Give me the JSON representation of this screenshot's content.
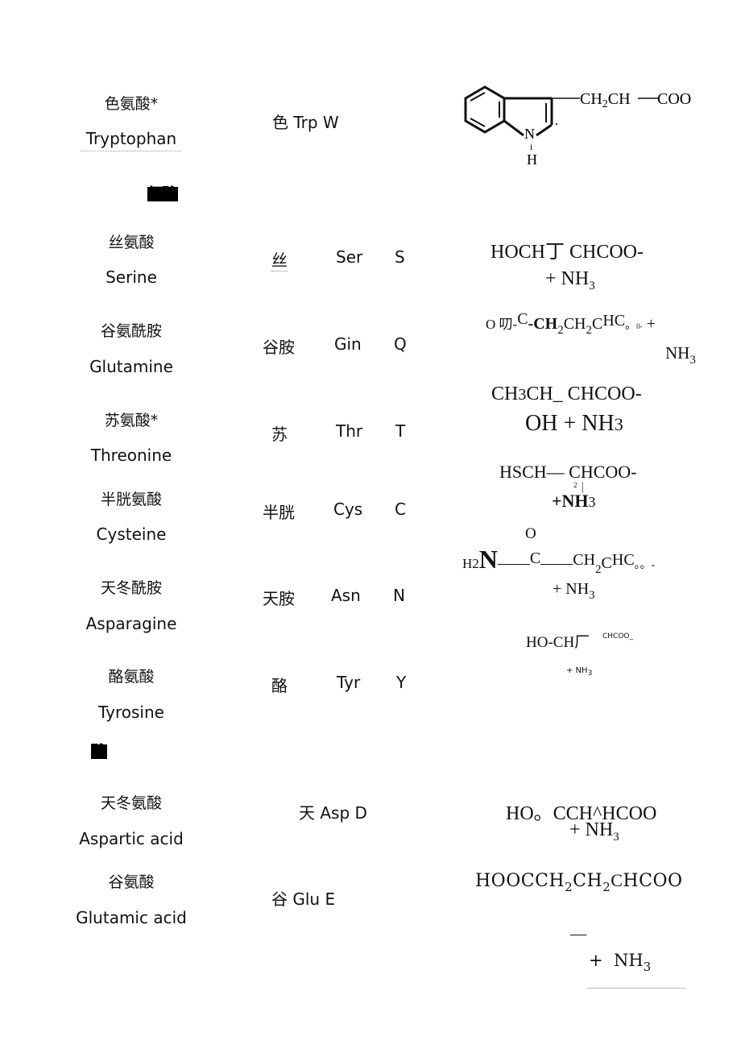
{
  "rows": [
    {
      "cn": "色氨酸*",
      "en": "Tryptophan",
      "short_cn": "色",
      "three": "Trp",
      "one": "W",
      "inline_abbr": "色  Trp W"
    },
    {
      "cn": "丝氨酸",
      "en": "Serine",
      "short_cn": "丝",
      "three": "Ser",
      "one": "S"
    },
    {
      "cn": "谷氨酰胺",
      "en": "Glutamine",
      "short_cn": "谷胺",
      "three": "Gin",
      "one": "Q"
    },
    {
      "cn": "苏氨酸*",
      "en": "Threonine",
      "short_cn": "苏",
      "three": "Thr",
      "one": "T"
    },
    {
      "cn": "半胱氨酸",
      "en": "Cysteine",
      "short_cn": "半胱",
      "three": "Cys",
      "one": "C"
    },
    {
      "cn": "天冬酰胺",
      "en": "Asparagine",
      "short_cn": "天胺",
      "three": "Asn",
      "one": "N"
    },
    {
      "cn": "酪氨酸",
      "en": "Tyrosine",
      "short_cn": "酪",
      "three": "Tyr",
      "one": "Y"
    },
    {
      "cn": "天冬氨酸",
      "en": "Aspartic acid",
      "inline_abbr": "天  Asp D"
    },
    {
      "cn": "谷氨酸",
      "en": "Glutamic acid",
      "inline_abbr": "谷  Glu E"
    }
  ],
  "sections": {
    "polar": "氨酸",
    "acidic": "酸"
  },
  "formulas": {
    "trp": {
      "chain_a": "CH",
      "chain_sub": "2",
      "chain_b": "CH",
      "chain_c": "COO",
      "n": "N",
      "h": "H",
      "dot": "·",
      "i": "i"
    },
    "ser": {
      "line1": "HOCH丁 CHCOO-",
      "line2_a": "+ NH",
      "line2_sub": "3"
    },
    "gln": {
      "p1": "O 叨-",
      "p2": "C",
      "p3": "-CH",
      "s1": "2",
      "p4": "CH",
      "s2": "2",
      "p5": "C",
      "p6": "HC",
      "p7": "。",
      "p8": "0-",
      "p9": "+",
      "nh": "NH",
      "nh_sub": "3"
    },
    "thr": {
      "line1_a": "CH",
      "line1_sub": "3",
      "line1_b": "CH_ CHCOO-",
      "line2_a": "OH + NH",
      "line2_sub": "3"
    },
    "cys": {
      "line1": "HSCH— CHCOO-",
      "two": "2",
      "line2_a": "+NH",
      "line2_sub": "3"
    },
    "asn": {
      "o": "O",
      "h2": "H2",
      "n": "N",
      "c": "C",
      "ch": "CH",
      "s": "2",
      "c2": "C",
      "hc": "HC",
      "tail": "。。-",
      "nh_a": "+ NH",
      "nh_sub": "3"
    },
    "tyr": {
      "line1": "HO-CH厂",
      "small": "CHCOO_",
      "line2_a": "+ NH",
      "line2_sub": "3"
    },
    "asp": {
      "line1": "HO。CCH^HCOO",
      "line2_a": "+ NH",
      "line2_sub": "3"
    },
    "glu": {
      "a": "HOOCCH",
      "s1": "2",
      "b": "CH",
      "s2": "2",
      "c": "C",
      "d": "HCOO",
      "dash": "—",
      "nh_a": "+  NH",
      "nh_sub": "3"
    }
  }
}
